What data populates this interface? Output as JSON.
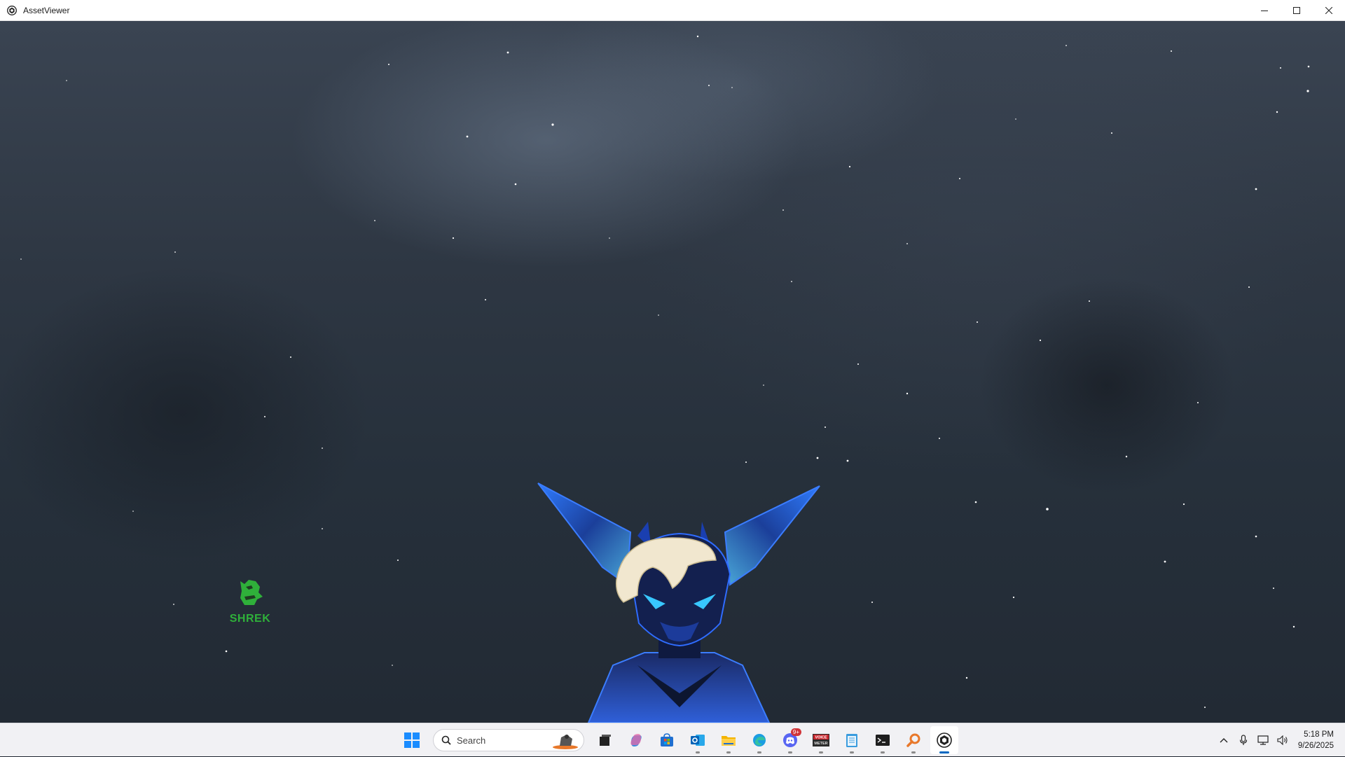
{
  "window": {
    "title": "AssetViewer",
    "controls": [
      "minimize",
      "maximize",
      "close"
    ]
  },
  "scene": {
    "background": "starry night sky",
    "logo": {
      "text": "SHREK",
      "color": "#2fb03a",
      "icon": "shrek-logo-icon"
    },
    "model": "blue cat-eared avatar with blond hair"
  },
  "taskbar": {
    "search": {
      "label": "Search"
    },
    "apps": [
      {
        "name": "Start",
        "icon": "windows-start-icon"
      },
      {
        "name": "Task View",
        "icon": "task-view-icon"
      },
      {
        "name": "Copilot",
        "icon": "copilot-icon"
      },
      {
        "name": "Microsoft Store",
        "icon": "store-icon"
      },
      {
        "name": "Outlook",
        "icon": "outlook-icon"
      },
      {
        "name": "File Explorer",
        "icon": "folder-icon"
      },
      {
        "name": "Edge",
        "icon": "edge-icon"
      },
      {
        "name": "Discord",
        "icon": "discord-icon",
        "badge": "9+"
      },
      {
        "name": "VoiceMeeter",
        "icon": "voicemeeter-icon",
        "text": "VOICE METER"
      },
      {
        "name": "Notepad",
        "icon": "notepad-icon"
      },
      {
        "name": "Terminal",
        "icon": "terminal-icon"
      },
      {
        "name": "Search Tool",
        "icon": "magnifier-icon"
      },
      {
        "name": "AssetViewer",
        "icon": "asset-viewer-icon",
        "active": true
      }
    ],
    "tray": {
      "icons": [
        "chevron-up-icon",
        "microphone-icon",
        "network-icon",
        "speaker-icon"
      ],
      "time": "5:18 PM",
      "date": "9/26/2025"
    }
  }
}
